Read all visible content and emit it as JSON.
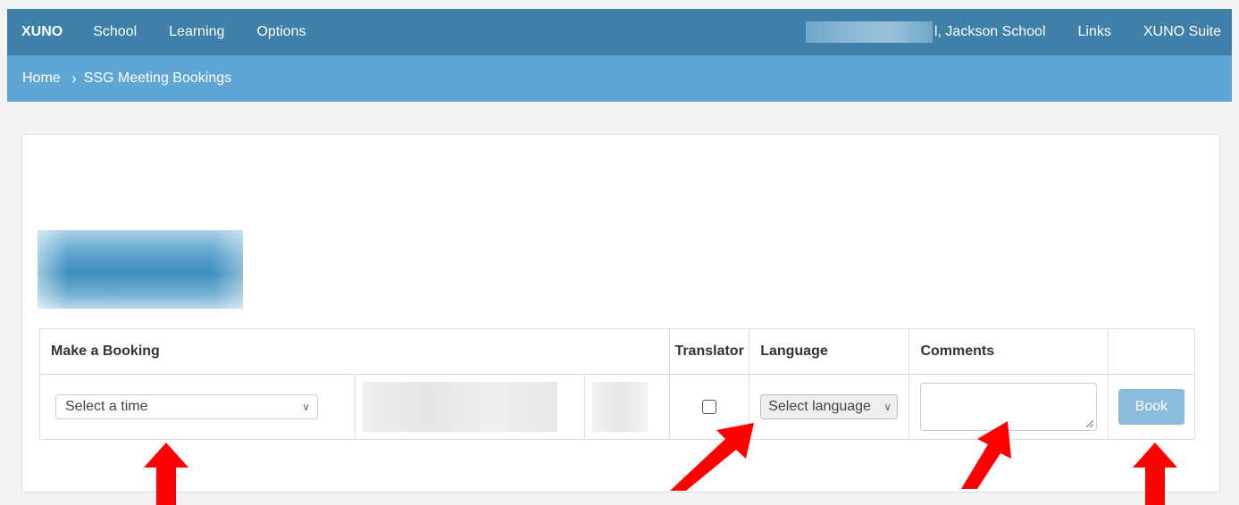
{
  "nav": {
    "brand": "XUNO",
    "items": [
      "School",
      "Learning",
      "Options"
    ],
    "user_suffix": "l, Jackson School",
    "links": "Links",
    "suite": "XUNO Suite"
  },
  "breadcrumb": {
    "home": "Home",
    "current": "SSG Meeting Bookings"
  },
  "table": {
    "headers": {
      "booking": "Make a Booking",
      "translator": "Translator",
      "language": "Language",
      "comments": "Comments"
    },
    "row": {
      "time_placeholder": "Select a time",
      "language_placeholder": "Select language",
      "book_label": "Book"
    }
  },
  "colors": {
    "nav_bg": "#3f80a8",
    "breadcrumb_bg": "#5ea7d5",
    "book_btn": "#8bbcdc",
    "arrow": "#ff0000"
  }
}
